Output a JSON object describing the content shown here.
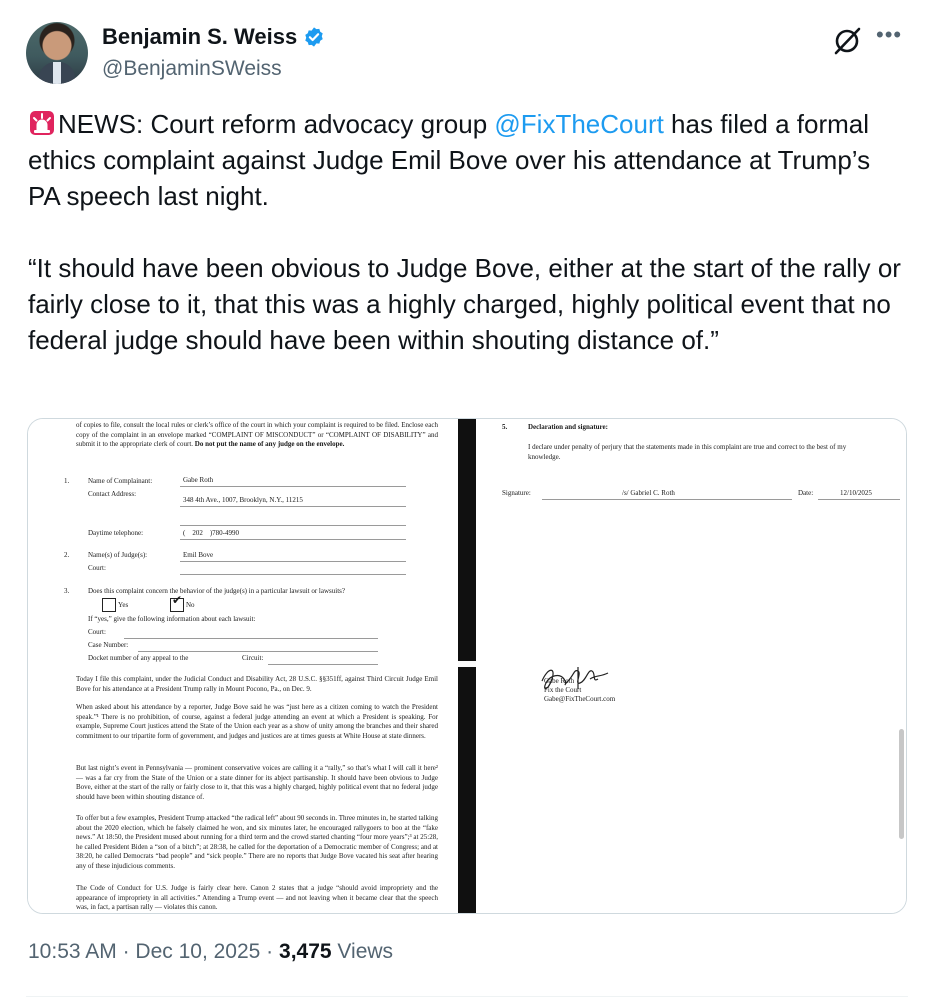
{
  "author": {
    "name": "Benjamin S. Weiss",
    "handle": "@BenjaminSWeiss",
    "verified": true
  },
  "icons": {
    "verified": "verified-badge-icon",
    "grok": "grok-icon",
    "more": "more-icon",
    "siren": "siren-emoji-icon"
  },
  "colors": {
    "accent": "#1d9bf0",
    "text": "#0f1419",
    "secondary": "#536471"
  },
  "tweet": {
    "part1": "NEWS: Court reform advocacy group ",
    "mention": "@FixTheCourt",
    "part2": " has filed a formal ethics complaint against Judge Emil Bove over his attendance at Trump’s PA speech last night.\n\n“It should have been obvious to Judge Bove, either at the start of the rally or fairly close to it, that this was a highly charged, highly political event that no federal judge should have been within shouting distance of.”"
  },
  "document": {
    "left": {
      "intro_top": "of copies to file, consult the local rules or clerk’s office of the court in which your complaint is required to be filed. Enclose each copy of the complaint in an envelope marked “COMPLAINT OF MISCONDUCT” or “COMPLAINT OF DISABILITY” and submit it to the appropriate clerk of court.",
      "intro_bold": "Do not put the name of any judge on the envelope.",
      "item1_num": "1.",
      "complainant_label": "Name of Complainant:",
      "complainant_value": "Gabe Roth",
      "address_label": "Contact Address:",
      "address_value": "348 4th Ave., 1007, Brooklyn, N.Y., 11215",
      "phone_label": "Daytime telephone:",
      "phone_value": "(    202    )780-4990",
      "item2_num": "2.",
      "judge_label": "Name(s) of Judge(s):",
      "judge_value": "Emil Bove",
      "court_label": "Court:",
      "item3_num": "3.",
      "q3": "Does this complaint concern the behavior of the judge(s) in a particular lawsuit or lawsuits?",
      "yes": "Yes",
      "no": "No",
      "if_yes": "If “yes,” give the following information about each lawsuit:",
      "court2": "Court:",
      "case_number": "Case Number:",
      "docket": "Docket number of any appeal to the",
      "circuit": "Circuit:",
      "p1": "Today I file this complaint, under the Judicial Conduct and Disability Act, 28 U.S.C. §§351ff, against Third Circuit Judge Emil Bove for his attendance at a President Trump rally in Mount Pocono, Pa., on Dec. 9.",
      "p2": "When asked about his attendance by a reporter, Judge Bove said he was “just here as a citizen coming to watch the President speak.”¹ There is no prohibition, of course, against a federal judge attending an event at which a President is speaking. For example, Supreme Court justices attend the State of the Union each year as a show of unity among the branches and their shared commitment to our tripartite form of government, and judges and justices are at times guests at White House at state dinners.",
      "p3": "But last night’s event in Pennsylvania — prominent conservative voices are calling it a “rally,” so that’s what I will call it here² — was a far cry from the State of the Union or a state dinner for its abject partisanship. It should have been obvious to Judge Bove, either at the start of the rally or fairly close to it, that this was a highly charged, highly political event that no federal judge should have been within shouting distance of.",
      "p4": "To offer but a few examples, President Trump attacked “the radical left” about 90 seconds in. Three minutes in, he started talking about the 2020 election, which he falsely claimed he won, and six minutes later, he encouraged rallygoers to boo at the “fake news.” At 18:50, the President mused about running for a third term and the crowd started chanting “four more years”;³ at 25:28, he called President Biden a “son of a bitch”; at 28:38, he called for the deportation of a Democratic member of Congress; and at 38:20, he called Democrats “bad people” and “sick people.” There are no reports that Judge Bove vacated his seat after hearing any of these injudicious comments.",
      "p5": "The Code of Conduct for U.S. Judge is fairly clear here. Canon 2 states that a judge “should avoid impropriety and the appearance of impropriety in all activities.” Attending a Trump event — and not leaving when it became clear that the speech was, in fact, a partisan rally — violates this canon."
    },
    "right": {
      "item5_num": "5.",
      "item5_title": "Declaration and signature:",
      "declaration": "I declare under penalty of perjury that the statements made in this complaint are true and correct to the best of my knowledge.",
      "signature_label": "Signature:",
      "signature_value": "/s/ Gabriel C. Roth",
      "date_label": "Date:",
      "date_value": "12/10/2025",
      "signer_line1": "Gabe Roth",
      "signer_line2": "Fix the Court",
      "signer_email": "Gabe@FixTheCourt.com"
    }
  },
  "footer": {
    "time": "10:53 AM",
    "sep": " · ",
    "date": "Dec 10, 2025",
    "views_count": "3,475",
    "views_label": " Views"
  }
}
